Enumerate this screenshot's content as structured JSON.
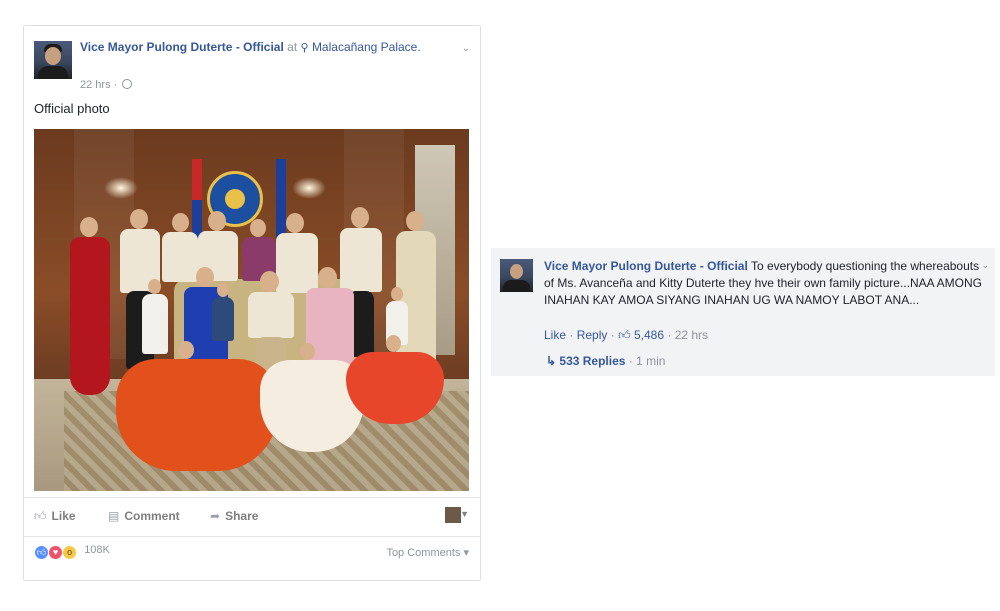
{
  "post": {
    "author": "Vice Mayor Pulong Duterte - Official",
    "at_word": "at",
    "location": "Malacañang Palace.",
    "time": "22 hrs ·",
    "caption": "Official photo",
    "actions": {
      "like": "Like",
      "comment": "Comment",
      "share": "Share"
    },
    "reactions_count": "108K",
    "top_comments": "Top Comments ▾",
    "icons": [
      "location-pin-icon",
      "globe-icon",
      "chevron-down-icon",
      "like-icon",
      "comment-icon",
      "share-icon"
    ]
  },
  "comment": {
    "author": "Vice Mayor Pulong Duterte - Official",
    "body": "To everybody questioning the whereabouts of Ms. Avanceña and Kitty Duterte they hve their own family picture...NAA AMONG INAHAN KAY AMOA SIYANG INAHAN UG WA NAMOY LABOT ANA...",
    "like": "Like",
    "reply": "Reply",
    "like_count": "5,486",
    "time": "22 hrs",
    "replies": "533 Replies",
    "replies_time": "1 min"
  },
  "colors": {
    "link": "#365899",
    "muted": "#90949c",
    "comment_bg": "#f2f3f5"
  }
}
